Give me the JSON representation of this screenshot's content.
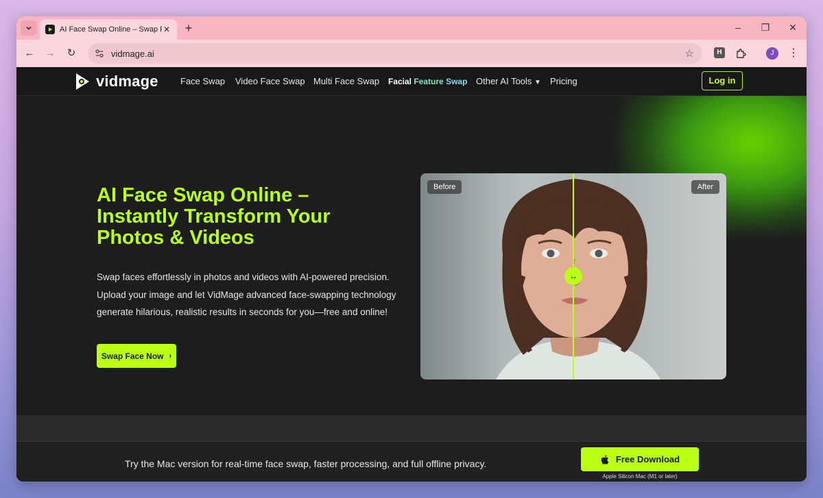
{
  "browser": {
    "tab_title": "AI Face Swap Online – Swap Fac",
    "new_tab_label": "+",
    "url": "vidmage.ai",
    "profile_initial": "J",
    "extension_label": "H"
  },
  "site": {
    "logo_text": "vidmage",
    "nav": {
      "face_swap": "Face Swap",
      "video_face_swap": "Video Face Swap",
      "multi_face_swap": "Multi Face Swap",
      "featured_w1": "Facial",
      "featured_w2": "Feature",
      "featured_w3": "Swap",
      "other_tools": "Other AI Tools",
      "pricing": "Pricing"
    },
    "login_label": "Log in"
  },
  "hero": {
    "title_line1": "AI Face Swap Online –",
    "title_line2": "Instantly Transform Your",
    "title_line3": "Photos & Videos",
    "desc_line1": "Swap faces effortlessly in photos and videos with AI-powered precision.",
    "desc_line2": "Upload your image and let VidMage advanced face-swapping technology",
    "desc_line3": "generate hilarious, realistic results in seconds for you—free and online!",
    "cta_label": "Swap Face Now",
    "before_label": "Before",
    "after_label": "After",
    "handle_symbol": "↔"
  },
  "mac_banner": {
    "text": "Try the Mac version for real-time face swap, faster processing, and full offline privacy.",
    "download_label": "Free Download",
    "download_sub": "Apple Silicon Mac (M1 or later)"
  },
  "colors": {
    "accent": "#b9ff16",
    "tab_strip": "#f8b6c2",
    "page_bg": "#1d1d1d"
  }
}
